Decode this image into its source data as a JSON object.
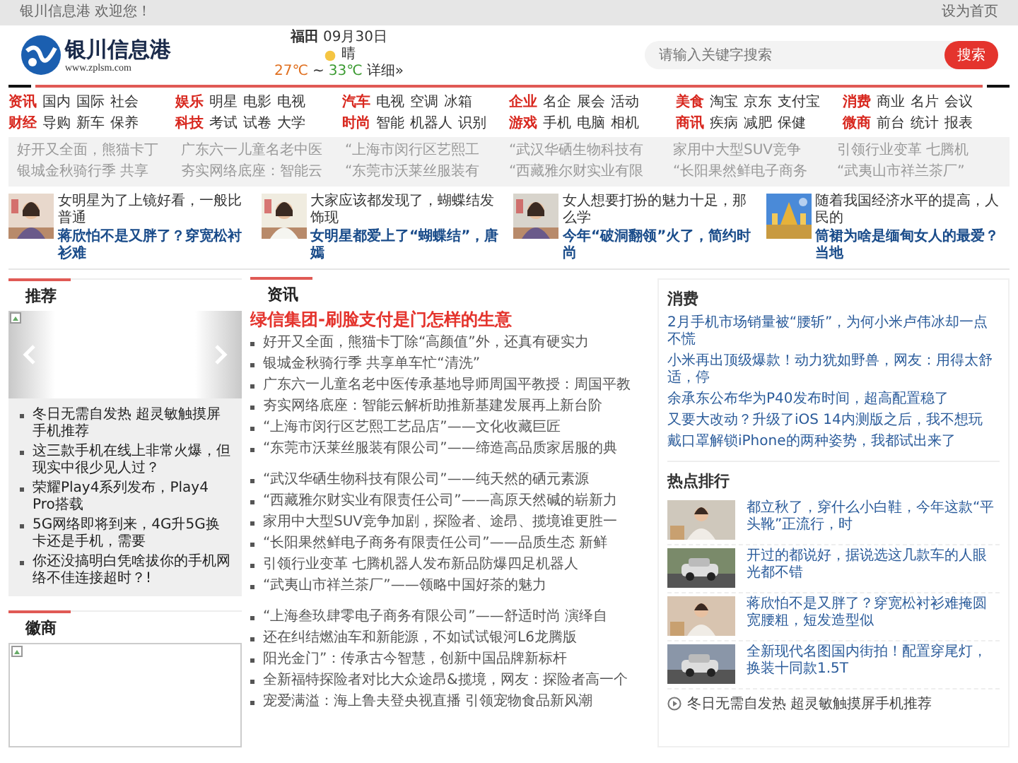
{
  "top_bar": {
    "welcome": "银川信息港 欢迎您！",
    "set_home": "设为首页"
  },
  "header": {
    "logo_name": "银川信息港",
    "logo_url": "www.zplsm.com",
    "weather": {
      "city": "福田",
      "date": "09月30日",
      "condition": "晴",
      "low": "27℃",
      "sep": "~",
      "high": "33℃",
      "details": "详细»"
    },
    "search": {
      "placeholder": "请输入关键字搜索",
      "button": "搜索"
    }
  },
  "nav": [
    {
      "category": "资讯",
      "items": [
        "国内",
        "国际",
        "社会"
      ]
    },
    {
      "category": "娱乐",
      "items": [
        "明星",
        "电影",
        "电视"
      ]
    },
    {
      "category": "汽车",
      "items": [
        "电视",
        "空调",
        "冰箱"
      ]
    },
    {
      "category": "企业",
      "items": [
        "名企",
        "展会",
        "活动"
      ]
    },
    {
      "category": "美食",
      "items": [
        "淘宝",
        "京东",
        "支付宝"
      ]
    },
    {
      "category": "消费",
      "items": [
        "商业",
        "名片",
        "会议"
      ]
    },
    {
      "category": "财经",
      "items": [
        "导购",
        "新车",
        "保养"
      ]
    },
    {
      "category": "科技",
      "items": [
        "考试",
        "试卷",
        "大学"
      ]
    },
    {
      "category": "时尚",
      "items": [
        "智能",
        "机器人",
        "识别"
      ]
    },
    {
      "category": "游戏",
      "items": [
        "手机",
        "电脑",
        "相机"
      ]
    },
    {
      "category": "商讯",
      "items": [
        "疾病",
        "减肥",
        "保健"
      ]
    },
    {
      "category": "微商",
      "items": [
        "前台",
        "统计",
        "报表"
      ]
    }
  ],
  "quick_links": [
    "好开又全面，熊猫卡丁",
    "广东六一儿童名老中医",
    "“上海市闵行区艺熙工",
    "“武汉华硒生物科技有",
    "家用中大型SUV竞争",
    "引领行业变革 七腾机",
    "银城金秋骑行季 共享",
    "夯实网络底座：智能云",
    "“东莞市沃莱丝服装有",
    "“西藏雅尔财实业有限",
    "“长阳果然鲜电子商务",
    "“武夷山市祥兰茶厂”"
  ],
  "featured": [
    {
      "intro": "女明星为了上镜好看，一般比普通",
      "headline": "蒋欣怕不是又胖了？穿宽松衬衫难"
    },
    {
      "intro": "大家应该都发现了，蝴蝶结发饰现",
      "headline": "女明星都爱上了“蝴蝶结”，唐嫣"
    },
    {
      "intro": "女人想要打扮的魅力十足，那么学",
      "headline": "今年“破洞翻领”火了，简约时尚"
    },
    {
      "intro": "随着我国经济水平的提高，人民的",
      "headline": "筒裙为啥是缅甸女人的最爱？当地"
    }
  ],
  "recommend": {
    "title": "推荐",
    "items": [
      "冬日无需自发热 超灵敏触摸屏手机推荐",
      "这三款手机在线上非常火爆，但现实中很少见人过？",
      "荣耀Play4系列发布，Play4 Pro搭载",
      "5G网络即将到来，4G升5G换卡还是手机，需要",
      "你还没搞明白凭啥拔你的手机网络不佳连接超时？!"
    ]
  },
  "weishang": {
    "title": "徽商"
  },
  "news": {
    "title": "资讯",
    "headline": "绿信集团-刷脸支付是门怎样的生意",
    "groups": [
      [
        "好开又全面，熊猫卡丁除“高颜值”外，还真有硬实力",
        "银城金秋骑行季 共享单车忙“清洗”",
        "广东六一儿童名老中医传承基地导师周国平教授：周国平教",
        "夯实网络底座：智能云解析助推新基建发展再上新台阶",
        "“上海市闵行区艺熙工艺品店”——文化收藏巨匠",
        "“东莞市沃莱丝服装有限公司”——缔造高品质家居服的典"
      ],
      [
        "“武汉华硒生物科技有限公司”——纯天然的硒元素源",
        "“西藏雅尔财实业有限责任公司”——高原天然碱的崭新力",
        "家用中大型SUV竞争加剧，探险者、途昂、揽境谁更胜一",
        "“长阳果然鲜电子商务有限责任公司”——品质生态 新鲜",
        "引领行业变革 七腾机器人发布新品防爆四足机器人",
        "“武夷山市祥兰茶厂”——领略中国好茶的魅力"
      ],
      [
        "“上海叁玖肆零电子商务有限公司”——舒适时尚 演绎自",
        "还在纠结燃油车和新能源，不如试试银河L6龙腾版",
        "阳光金门”：传承古今智慧，创新中国品牌新标杆",
        "全新福特探险者对比大众途昂&揽境，网友：探险者高一个",
        "宠爱满溢：海上鲁夫登央视直播 引领宠物食品新风潮"
      ]
    ]
  },
  "consume": {
    "title": "消费",
    "items": [
      "2月手机市场销量被“腰斩”，为何小米卢伟冰却一点不慌",
      "小米再出顶级爆款！动力犹如野兽，网友：用得太舒适，停",
      "余承东公布华为P40发布时间，超高配置稳了",
      "又要大改动？升级了iOS 14内测版之后，我不想玩",
      "戴口罩解锁iPhone的两种姿势，我都试出来了"
    ]
  },
  "hot": {
    "title": "热点排行",
    "items": [
      "都立秋了，穿什么小白鞋，今年这款“平头靴”正流行，时",
      "开过的都说好，据说选这几款车的人眼光都不错",
      "蒋欣怕不是又胖了？穿宽松衬衫难掩圆宽腰粗，短发造型似",
      "全新现代名图国内街拍！配置穿尾灯，换装十同款1.5T"
    ],
    "video": "冬日无需自发热 超灵敏触摸屏手机推荐"
  }
}
